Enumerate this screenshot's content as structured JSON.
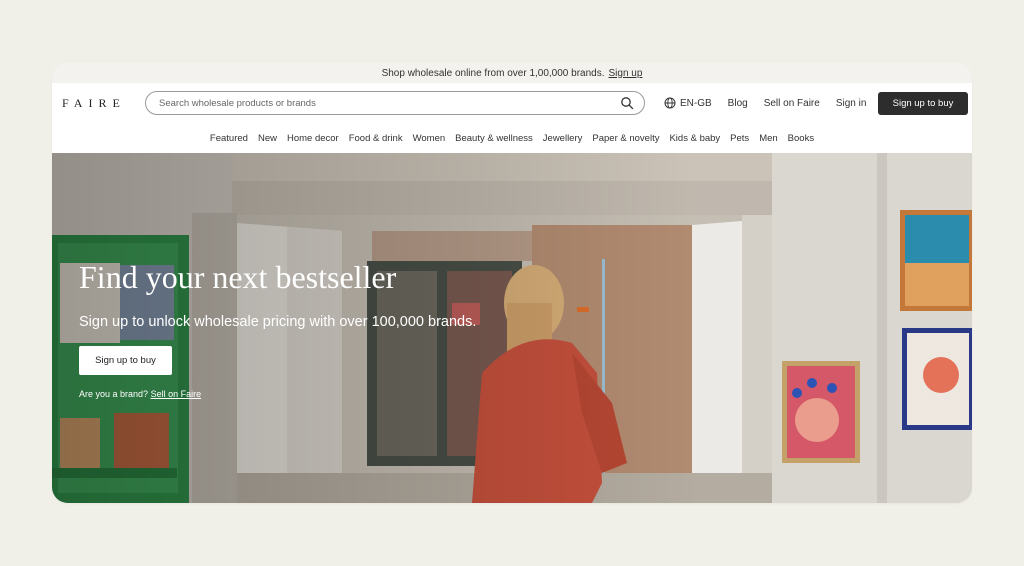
{
  "promo": {
    "text": "Shop wholesale online from over 1,00,000 brands.",
    "link": "Sign up"
  },
  "header": {
    "logo": "FAIRE",
    "search_placeholder": "Search wholesale products or brands",
    "language": "EN-GB",
    "links": [
      "Blog",
      "Sell on Faire",
      "Sign in"
    ],
    "cta": "Sign up to buy"
  },
  "categories": [
    "Featured",
    "New",
    "Home decor",
    "Food & drink",
    "Women",
    "Beauty & wellness",
    "Jewellery",
    "Paper & novelty",
    "Kids & baby",
    "Pets",
    "Men",
    "Books"
  ],
  "hero": {
    "title": "Find your next bestseller",
    "subtitle": "Sign up to unlock wholesale pricing with over 100,000 brands.",
    "button": "Sign up to buy",
    "brand_prompt": "Are you a brand?",
    "brand_link": "Sell on Faire"
  },
  "colors": {
    "page_bg": "#f0f0e8",
    "cta_dark": "#2d2d2d",
    "shelf_green": "#2e8a47",
    "person_dress": "#c8513d"
  },
  "icons": [
    "search-icon",
    "globe-icon"
  ]
}
